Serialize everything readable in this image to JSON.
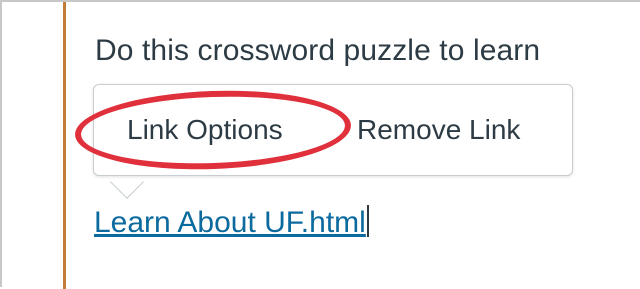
{
  "editor": {
    "intro_text": "Do this crossword puzzle to learn",
    "link_text": "Learn About UF.html"
  },
  "link_popover": {
    "link_options_label": "Link Options",
    "remove_link_label": "Remove Link"
  },
  "colors": {
    "accent_bar": "#c37b3a",
    "link": "#0b6a9e",
    "annotation_circle": "#e0303c",
    "text": "#2d3b45"
  }
}
